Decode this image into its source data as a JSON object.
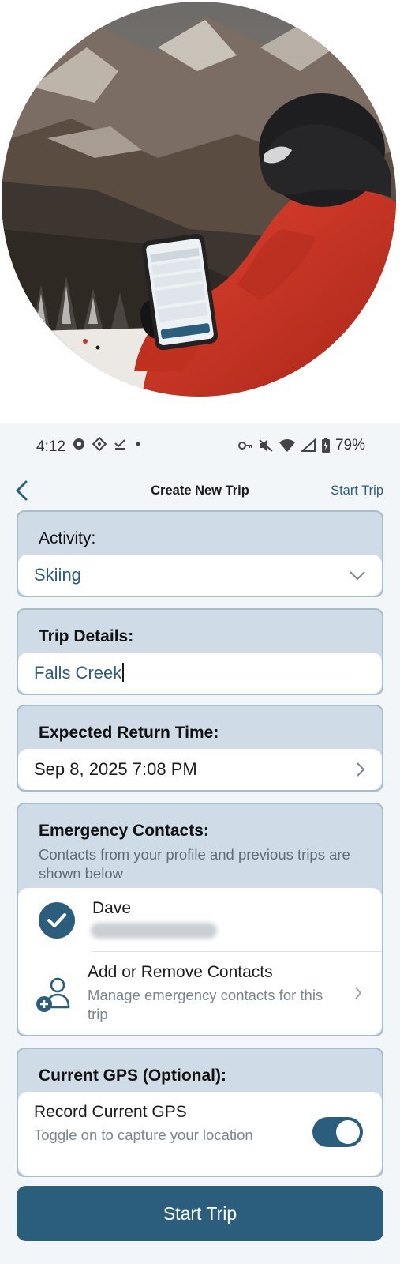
{
  "status_bar": {
    "time": "4:12",
    "battery": "79%",
    "left_icons": [
      "notification-icon",
      "diamond-icon",
      "check-icon",
      "dot-icon"
    ],
    "right_icons": [
      "key-icon",
      "mute-icon",
      "wifi-icon",
      "signal-icon",
      "battery-icon"
    ]
  },
  "app_bar": {
    "title": "Create New Trip",
    "action": "Start Trip"
  },
  "activity": {
    "label": "Activity:",
    "value": "Skiing"
  },
  "trip_details": {
    "label": "Trip Details:",
    "value": "Falls Creek"
  },
  "return_time": {
    "label": "Expected Return Time:",
    "value": "Sep 8, 2025 7:08 PM"
  },
  "emergency": {
    "label": "Emergency Contacts:",
    "subtitle": "Contacts from your profile and previous trips are shown below",
    "contacts": [
      {
        "name": "Dave",
        "selected": true
      }
    ],
    "manage": {
      "title": "Add or Remove Contacts",
      "subtitle": "Manage emergency contacts for this trip"
    }
  },
  "gps": {
    "label": "Current GPS (Optional):",
    "toggle_title": "Record Current GPS",
    "toggle_subtitle": "Toggle on to capture your location",
    "enabled": true
  },
  "primary_button": "Start Trip",
  "colors": {
    "accent": "#2b5d7d",
    "card_bg": "#cfdbe6",
    "screen_bg": "#f3f6f9"
  }
}
